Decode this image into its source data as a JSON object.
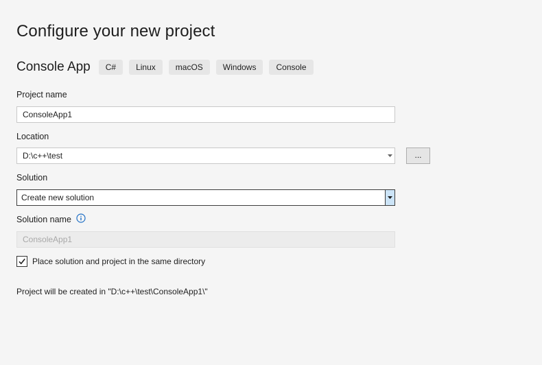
{
  "page": {
    "title": "Configure your new project"
  },
  "template": {
    "name": "Console App",
    "tags": [
      "C#",
      "Linux",
      "macOS",
      "Windows",
      "Console"
    ]
  },
  "project_name": {
    "label": "Project name",
    "value": "ConsoleApp1"
  },
  "location": {
    "label": "Location",
    "value": "D:\\c++\\test",
    "browse_label": "..."
  },
  "solution": {
    "label": "Solution",
    "selected": "Create new solution"
  },
  "solution_name": {
    "label": "Solution name",
    "value": "ConsoleApp1",
    "enabled": false,
    "info_icon": "info-circle-icon"
  },
  "same_directory": {
    "label": "Place solution and project in the same directory",
    "checked": true
  },
  "footer": {
    "created_path_text": "Project will be created in \"D:\\c++\\test\\ConsoleApp1\\\""
  },
  "colors": {
    "background": "#f5f5f5",
    "tag_background": "#e6e6e6",
    "info_icon": "#1f6fc5",
    "dropdown_arrow_highlight": "#cce4f7"
  }
}
